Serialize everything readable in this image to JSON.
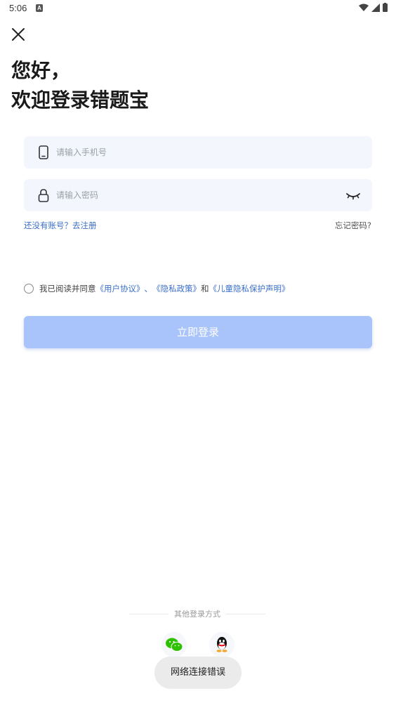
{
  "status_bar": {
    "time": "5:06",
    "notification_letter": "A"
  },
  "header": {
    "greeting_line1": "您好，",
    "greeting_line2": "欢迎登录错题宝"
  },
  "form": {
    "phone_placeholder": "请输入手机号",
    "password_placeholder": "请输入密码",
    "register_link": "还没有账号？去注册",
    "forgot_link": "忘记密码?"
  },
  "agreement": {
    "prefix": "我已阅读并同意",
    "user_agreement": "《用户协议》",
    "separator": "、",
    "privacy_policy": "《隐私政策》",
    "and": "和",
    "child_privacy": "《儿童隐私保护声明》"
  },
  "login_button": "立即登录",
  "other_login": {
    "label": "其他登录方式"
  },
  "toast": "网络连接错误",
  "colors": {
    "accent": "#3b6fc9",
    "button_disabled": "#a9c3fb",
    "field_bg": "#f3f6fd",
    "wechat": "#2dc100"
  }
}
